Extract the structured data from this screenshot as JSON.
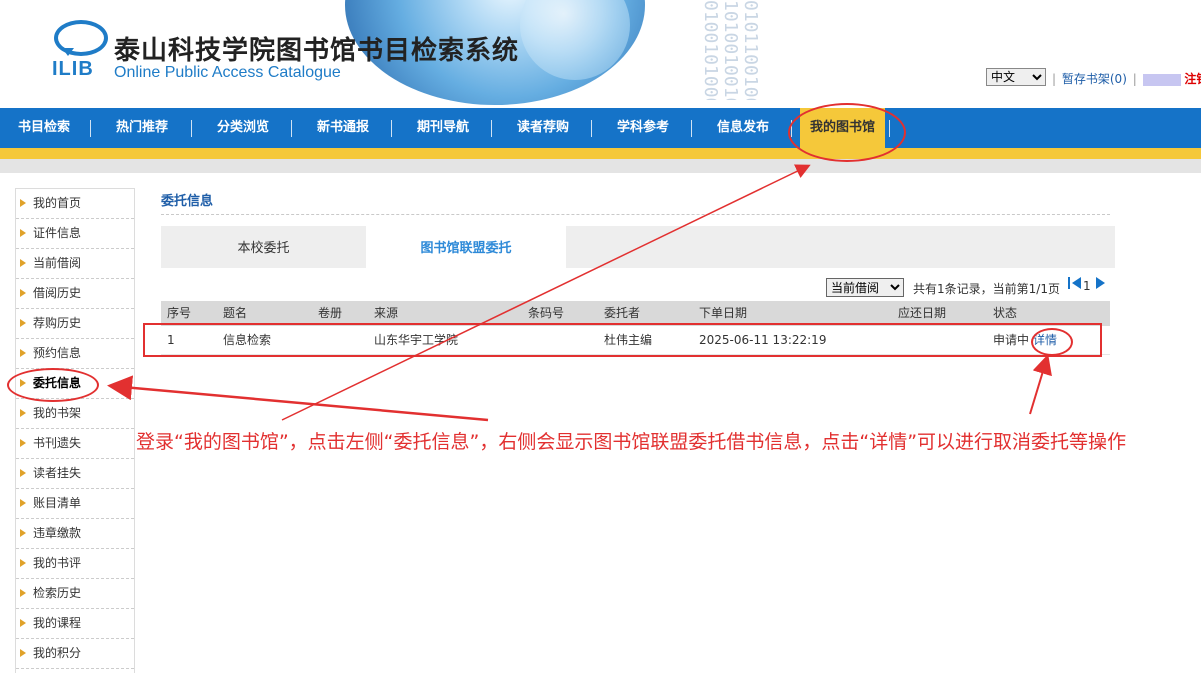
{
  "header": {
    "logo_text": "ILIB",
    "title_cn": "泰山科技学院图书馆书目检索系统",
    "title_en": "Online Public Access Catalogue",
    "binary_text": "0101100100101 1010010010101 0100101000001",
    "language_selected": "中文",
    "cart_link": "暂存书架(0)",
    "logout_link": "注销"
  },
  "nav": {
    "items": [
      {
        "label": "书目检索"
      },
      {
        "label": "热门推荐"
      },
      {
        "label": "分类浏览"
      },
      {
        "label": "新书通报"
      },
      {
        "label": "期刊导航"
      },
      {
        "label": "读者荐购"
      },
      {
        "label": "学科参考"
      },
      {
        "label": "信息发布"
      },
      {
        "label": "我的图书馆"
      }
    ],
    "active": "我的图书馆"
  },
  "sidebar": {
    "items": [
      {
        "label": "我的首页"
      },
      {
        "label": "证件信息"
      },
      {
        "label": "当前借阅"
      },
      {
        "label": "借阅历史"
      },
      {
        "label": "荐购历史"
      },
      {
        "label": "预约信息"
      },
      {
        "label": "委托信息"
      },
      {
        "label": "我的书架"
      },
      {
        "label": "书刊遗失"
      },
      {
        "label": "读者挂失"
      },
      {
        "label": "账目清单"
      },
      {
        "label": "违章缴款"
      },
      {
        "label": "我的书评"
      },
      {
        "label": "检索历史"
      },
      {
        "label": "我的课程"
      },
      {
        "label": "我的积分"
      }
    ],
    "active": "委托信息"
  },
  "main": {
    "section_title": "委托信息",
    "tabs": [
      {
        "label": "本校委托"
      },
      {
        "label": "图书馆联盟委托"
      }
    ],
    "active_tab": "图书馆联盟委托",
    "filter_selected": "当前借阅",
    "pager_text": "共有1条记录，当前第1/1页",
    "pager_page": "1",
    "table": {
      "columns": [
        "序号",
        "题名",
        "卷册",
        "来源",
        "条码号",
        "委托者",
        "下单日期",
        "应还日期",
        "状态"
      ],
      "rows": [
        {
          "no": "1",
          "title": "信息检索",
          "volume": "",
          "source": "山东华宇工学院",
          "barcode": "",
          "requester": "杜伟主编",
          "order_date": "2025-06-11 13:22:19",
          "due_date": "",
          "status": "申请中",
          "detail": "详情"
        }
      ]
    }
  },
  "annotation": {
    "text": "登录“我的图书馆”，点击左侧“委托信息”，右侧会显示图书馆联盟委托借书信息，点击“详情”可以进行取消委托等操作",
    "color": "#e23030"
  },
  "colors": {
    "nav_blue": "#1573c8",
    "gold": "#f5c83a",
    "link_blue": "#1f5ea8"
  }
}
